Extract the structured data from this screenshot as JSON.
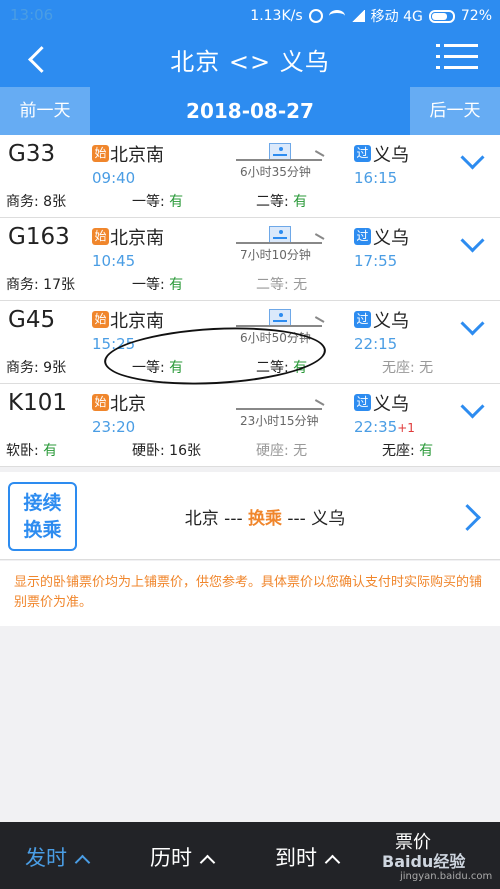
{
  "status_bar": {
    "time": "13:06",
    "speed": "1.13K/s",
    "carrier": "移动 4G",
    "battery": "72%"
  },
  "header": {
    "title": "北京 <> 义乌"
  },
  "date_bar": {
    "prev": "前一天",
    "date": "2018-08-27",
    "next": "后一天"
  },
  "trains": [
    {
      "code": "G33",
      "start_badge": "始",
      "dep_station": "北京南",
      "dep_time": "09:40",
      "duration": "6小时35分钟",
      "pass_badge": "过",
      "arr_station": "义乌",
      "arr_time": "16:15",
      "arr_plus": "",
      "seats": [
        {
          "label": "商务: 8张",
          "avail": ""
        },
        {
          "label": "一等: ",
          "avail": "有"
        },
        {
          "label": "二等: ",
          "avail": "有"
        },
        {
          "label": "",
          "avail": ""
        }
      ]
    },
    {
      "code": "G163",
      "start_badge": "始",
      "dep_station": "北京南",
      "dep_time": "10:45",
      "duration": "7小时10分钟",
      "pass_badge": "过",
      "arr_station": "义乌",
      "arr_time": "17:55",
      "arr_plus": "",
      "seats": [
        {
          "label": "商务: 17张",
          "avail": ""
        },
        {
          "label": "一等: ",
          "avail": "有"
        },
        {
          "label": "二等: 无",
          "avail": ""
        },
        {
          "label": "",
          "avail": ""
        }
      ]
    },
    {
      "code": "G45",
      "start_badge": "始",
      "dep_station": "北京南",
      "dep_time": "15:25",
      "duration": "6小时50分钟",
      "pass_badge": "过",
      "arr_station": "义乌",
      "arr_time": "22:15",
      "arr_plus": "",
      "seats": [
        {
          "label": "商务: 9张",
          "avail": ""
        },
        {
          "label": "一等: ",
          "avail": "有"
        },
        {
          "label": "二等: ",
          "avail": "有"
        },
        {
          "label": "无座: 无",
          "avail": ""
        }
      ]
    },
    {
      "code": "K101",
      "start_badge": "始",
      "dep_station": "北京",
      "dep_time": "23:20",
      "duration": "23小时15分钟",
      "pass_badge": "过",
      "arr_station": "义乌",
      "arr_time": "22:35",
      "arr_plus": "+1",
      "seats": [
        {
          "label": "软卧: ",
          "avail": "有"
        },
        {
          "label": "硬卧: 16张",
          "avail": ""
        },
        {
          "label": "硬座: 无",
          "avail": ""
        },
        {
          "label": "无座: ",
          "avail": "有"
        }
      ]
    }
  ],
  "transfer": {
    "box_line1": "接续",
    "box_line2": "换乘",
    "from": "北京 --- ",
    "mid": "换乘",
    "to": " --- 义乌"
  },
  "notice": "显示的卧铺票价均为上铺票价，供您参考。具体票价以您确认支付时实际购买的铺别票价为准。",
  "bottom_bar": {
    "depart": "发时",
    "duration": "历时",
    "arrive": "到时",
    "price": "票价"
  },
  "watermark": {
    "main": "Baidu经验",
    "sub": "jingyan.baidu.com"
  },
  "colors": {
    "primary": "#2d8cf0",
    "available": "#2b9a3a",
    "highlight": "#f0862c"
  }
}
